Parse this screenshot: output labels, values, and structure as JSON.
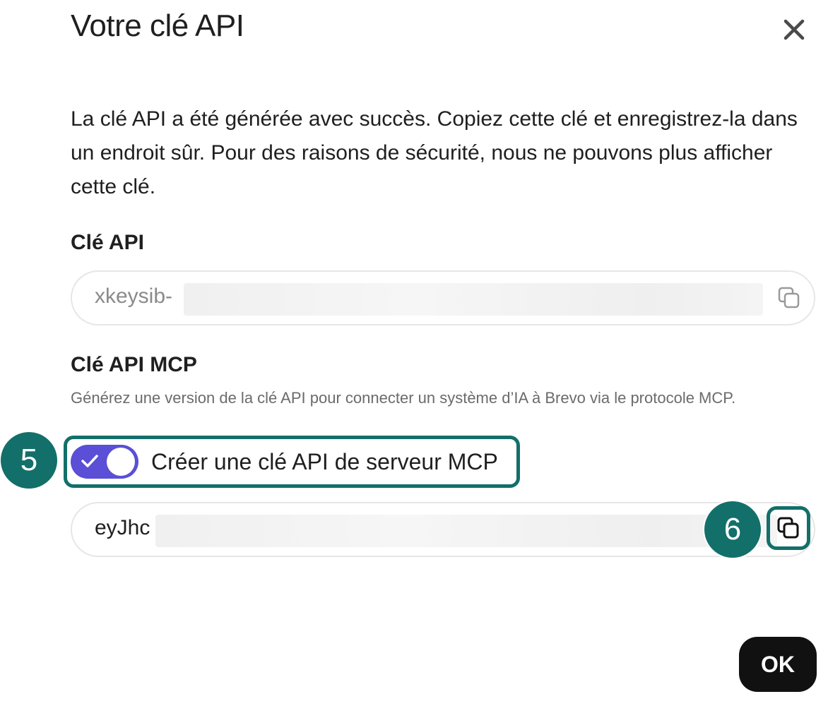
{
  "dialog": {
    "title": "Votre clé API",
    "description": "La clé API a été générée avec succès. Copiez cette clé et enregistrez-la dans un endroit sûr. Pour des raisons de sécurité, nous ne pouvons plus afficher cette clé."
  },
  "api_key": {
    "label": "Clé API",
    "value": "xkeysib-",
    "copy_icon": "copy-icon"
  },
  "mcp_key": {
    "label": "Clé API MCP",
    "hint": "Générez une version de la clé API pour connecter un système d’IA à Brevo via le protocole MCP.",
    "toggle_label": "Créer une clé API de serveur MCP",
    "toggle_on": true,
    "value": "eyJhc",
    "copy_icon": "copy-icon"
  },
  "annotations": {
    "step_toggle": "5",
    "step_copy": "6"
  },
  "footer": {
    "ok_label": "OK"
  },
  "colors": {
    "accent_teal": "#136f6a",
    "toggle_purple": "#5a4fd6",
    "ok_button": "#111111"
  }
}
